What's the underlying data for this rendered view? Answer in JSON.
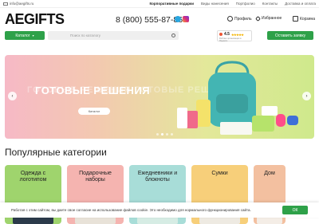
{
  "topbar": {
    "email": "info@aegifts.ru",
    "links": [
      "Корпоративные подарки",
      "Виды нанесения",
      "Портфолио",
      "Контакты",
      "Доставка и оплата"
    ]
  },
  "header": {
    "logo": "AEGIFTS",
    "phone": "8 (800) 555-87-86",
    "profile_label": "Профиль",
    "favorites_label": "Избранное",
    "cart_label": "Корзина"
  },
  "search": {
    "catalog_label": "Каталог",
    "placeholder": "Поиск по каталогу"
  },
  "rating": {
    "score": "4.5",
    "stars": "★★★★★",
    "source": "Рейтинг организации в Яндексе"
  },
  "request_label": "Оставить заявку",
  "banner": {
    "ghost_text": "ГОТОВЫЕ РЕШЕНИЯ ГОТОВЫЕ РЕШЕНИЯ",
    "title": "ГОТОВЫЕ РЕШЕНИЯ",
    "button_label": "Каталог",
    "slide_count": 4,
    "active_slide": 2
  },
  "section_title": "Популярные категории",
  "categories": [
    {
      "label": "Одежда с логотипом"
    },
    {
      "label": "Подарочные наборы"
    },
    {
      "label": "Ежедневники и блокноты"
    },
    {
      "label": "Сумки"
    },
    {
      "label": "Дом"
    }
  ],
  "cookie": {
    "text": "Работая с этим сайтом, вы даете свое согласие на использование файлов cookie. Это необходимо для нормального функционирования сайта.",
    "ok_label": "ОК"
  },
  "colors": {
    "accent": "#2ea149"
  }
}
